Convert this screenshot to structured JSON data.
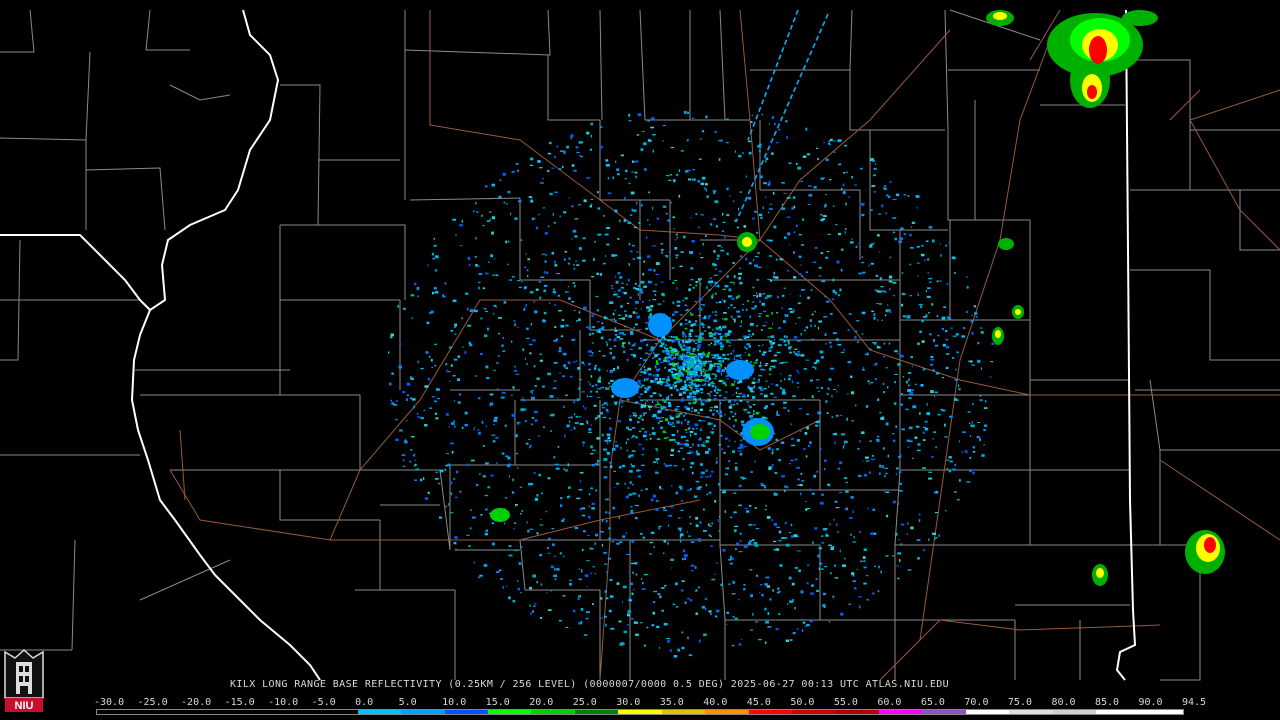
{
  "product": {
    "caption": "KILX LONG RANGE BASE REFLECTIVITY (0.25KM / 256 LEVEL) (0000007/0000 0.5 DEG) 2025-06-27 00:13 UTC  ATLAS.NIU.EDU",
    "radar_site": "KILX",
    "timestamp": "2025-06-27 00:13 UTC",
    "source": "ATLAS.NIU.EDU"
  },
  "logo": {
    "text": "NIU",
    "icon": "niu-tower-logo"
  },
  "colorbar": {
    "labels": [
      "-30.0",
      "-25.0",
      "-20.0",
      "-15.0",
      "-10.0",
      "-5.0",
      "0.0",
      "5.0",
      "10.0",
      "15.0",
      "20.0",
      "25.0",
      "30.0",
      "35.0",
      "40.0",
      "45.0",
      "50.0",
      "55.0",
      "60.0",
      "65.0",
      "70.0",
      "75.0",
      "80.0",
      "85.0",
      "90.0",
      "94.5"
    ],
    "colors": [
      "#000000",
      "#000000",
      "#000000",
      "#000000",
      "#000000",
      "#000000",
      "#00c0ff",
      "#00a0ff",
      "#0050ff",
      "#00ff00",
      "#00d000",
      "#008000",
      "#ffff00",
      "#e0c000",
      "#ff9000",
      "#ff0000",
      "#d00000",
      "#b00000",
      "#ff00ff",
      "#9050c0",
      "#ffffff",
      "#e0e0e0",
      "#d0d0d0",
      "#ffffff",
      "#ffffff"
    ]
  },
  "map_colors": {
    "background": "#000000",
    "county_lines": "#8a8a8a",
    "state_lines": "#ffffff",
    "roads": "#9a5a3a"
  }
}
